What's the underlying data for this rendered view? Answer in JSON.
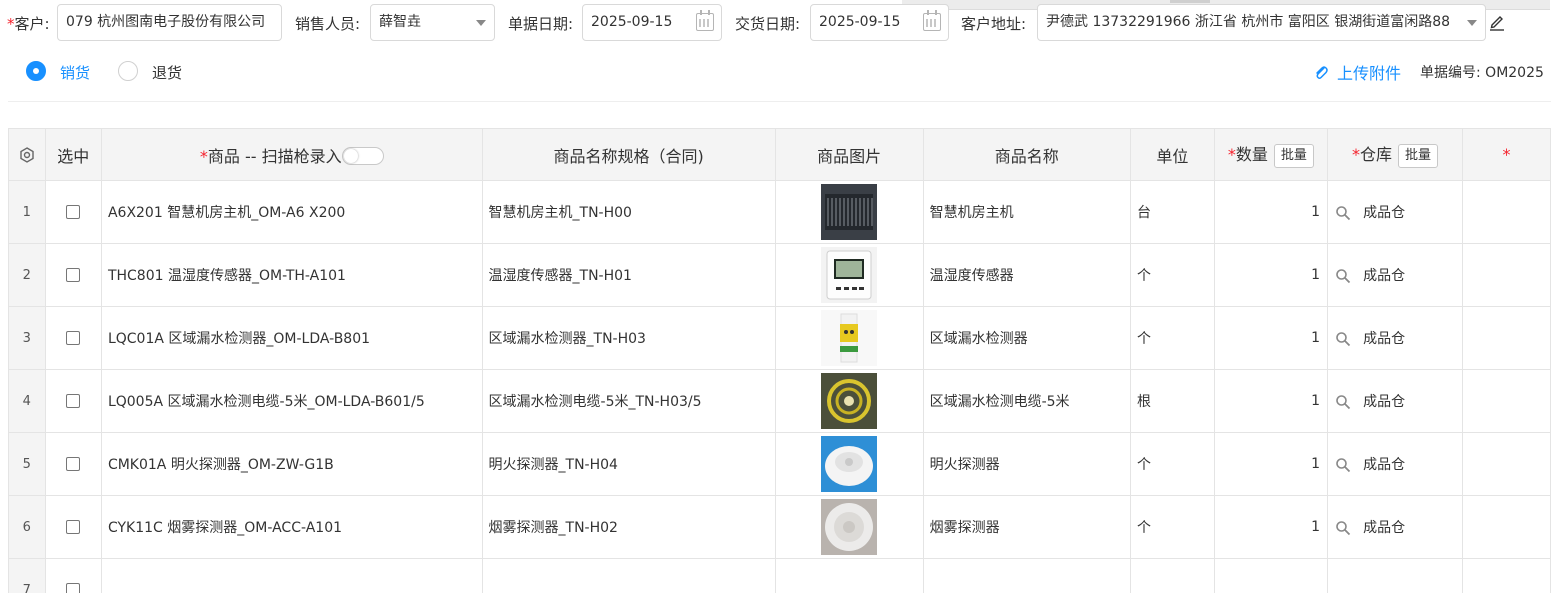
{
  "header": {
    "customer_label": "客户:",
    "customer_value": "079 杭州图南电子股份有限公司",
    "sales_label": "销售人员:",
    "sales_value": "薛智垚",
    "doc_date_label": "单据日期:",
    "doc_date_value": "2025-09-15",
    "delivery_date_label": "交货日期:",
    "delivery_date_value": "2025-09-15",
    "address_label": "客户地址:",
    "address_value": "尹德武 13732291966 浙江省 杭州市 富阳区 银湖街道富闲路88"
  },
  "mode": {
    "sale_label": "销货",
    "return_label": "退货",
    "selected": "销货"
  },
  "actions": {
    "upload_label": "上传附件",
    "doc_no_label": "单据编号:",
    "doc_no_value": "OM2025"
  },
  "table": {
    "headers": {
      "select": "选中",
      "product": "商品 -- 扫描枪录入",
      "spec": "商品名称规格（合同)",
      "image": "商品图片",
      "name": "商品名称",
      "unit": "单位",
      "qty": "数量",
      "warehouse": "仓库",
      "batch": "批量"
    },
    "rows": [
      {
        "idx": "1",
        "product": "A6X201 智慧机房主机_OM-A6 X200",
        "spec": "智慧机房主机_TN-H00",
        "name": "智慧机房主机",
        "unit": "台",
        "qty": "1",
        "warehouse": "成品仓",
        "image_icon": "server-host-photo"
      },
      {
        "idx": "2",
        "product": "THC801 温湿度传感器_OM-TH-A101",
        "spec": "温湿度传感器_TN-H01",
        "name": "温湿度传感器",
        "unit": "个",
        "qty": "1",
        "warehouse": "成品仓",
        "image_icon": "humidity-sensor-photo"
      },
      {
        "idx": "3",
        "product": "LQC01A 区域漏水检测器_OM-LDA-B801",
        "spec": "区域漏水检测器_TN-H03",
        "name": "区域漏水检测器",
        "unit": "个",
        "qty": "1",
        "warehouse": "成品仓",
        "image_icon": "leak-detector-photo"
      },
      {
        "idx": "4",
        "product": "LQ005A 区域漏水检测电缆-5米_OM-LDA-B601/5",
        "spec": "区域漏水检测电缆-5米_TN-H03/5",
        "name": "区域漏水检测电缆-5米",
        "unit": "根",
        "qty": "1",
        "warehouse": "成品仓",
        "image_icon": "leak-cable-photo"
      },
      {
        "idx": "5",
        "product": "CMK01A 明火探测器_OM-ZW-G1B",
        "spec": "明火探测器_TN-H04",
        "name": "明火探测器",
        "unit": "个",
        "qty": "1",
        "warehouse": "成品仓",
        "image_icon": "flame-detector-photo"
      },
      {
        "idx": "6",
        "product": "CYK11C 烟雾探测器_OM-ACC-A101",
        "spec": "烟雾探测器_TN-H02",
        "name": "烟雾探测器",
        "unit": "个",
        "qty": "1",
        "warehouse": "成品仓",
        "image_icon": "smoke-detector-photo"
      },
      {
        "idx": "7",
        "product": "",
        "spec": "",
        "name": "",
        "unit": "",
        "qty": "",
        "warehouse": "",
        "image_icon": ""
      }
    ]
  },
  "colors": {
    "accent": "#1890ff",
    "required": "#f5222d",
    "header_bg": "#f4f4f4",
    "border": "#e4e4e4"
  }
}
